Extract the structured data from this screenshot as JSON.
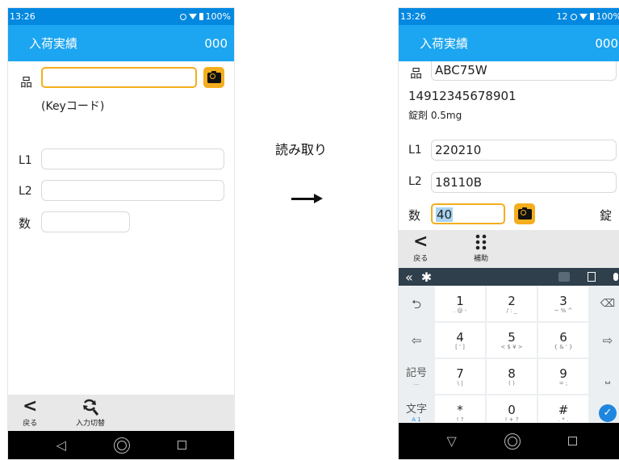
{
  "before": {
    "status": {
      "time": "13:26",
      "battery": "100%"
    },
    "header": {
      "title": "入荷実績",
      "code": "000"
    },
    "fields": {
      "hin_label": "品",
      "hin_value": "",
      "hin_note": "(Keyコード)",
      "l1_label": "L1",
      "l1_value": "",
      "l2_label": "L2",
      "l2_value": "",
      "qty_label": "数",
      "qty_value": ""
    },
    "bottom": {
      "back_glyph": "<",
      "back_label": "戻る",
      "switch_label": "入力切替"
    }
  },
  "transition": {
    "label": "読み取り"
  },
  "after": {
    "status": {
      "time": "13:26",
      "signal": "12",
      "battery": "100%"
    },
    "header": {
      "title": "入荷実績",
      "code": "000"
    },
    "fields": {
      "hin_label": "品",
      "hin_value": "ABC75W",
      "jan_code": "14912345678901",
      "product_name": "錠剤 0.5mg",
      "l1_label": "L1",
      "l1_value": "220210",
      "l2_label": "L2",
      "l2_value": "18110B",
      "qty_label": "数",
      "qty_value": "40",
      "unit": "錠"
    },
    "bottom": {
      "back_glyph": "<",
      "back_label": "戻る",
      "assist_label": "補助"
    },
    "keyboard": {
      "toolbar_collapse": "«",
      "keys": [
        {
          "main": "1",
          "sub": ". @ -"
        },
        {
          "main": "2",
          "sub": "/ : _"
        },
        {
          "main": "3",
          "sub": "~ % ^"
        },
        {
          "main": "4",
          "sub": "[ ' ]"
        },
        {
          "main": "5",
          "sub": "< $ ¥ >"
        },
        {
          "main": "6",
          "sub": "{ & ' }"
        },
        {
          "main": "7",
          "sub": "\\ |"
        },
        {
          "main": "8",
          "sub": "( )"
        },
        {
          "main": "9",
          "sub": "= ;"
        },
        {
          "main": "*",
          "sub": "! ?"
        },
        {
          "main": "0",
          "sub": "! + ?"
        },
        {
          "main": "#",
          "sub": ". * ."
        }
      ],
      "kigou_label": "記号",
      "kigou_sub": "...",
      "moji_label": "文字",
      "moji_sub": "A 1"
    }
  },
  "colors": {
    "status_bar": "#0388e0",
    "app_bar": "#1ca5f0",
    "focus_orange": "#f4ae1e",
    "keyboard_toolbar": "#2f3f4c",
    "enter_blue": "#1f86e0"
  }
}
